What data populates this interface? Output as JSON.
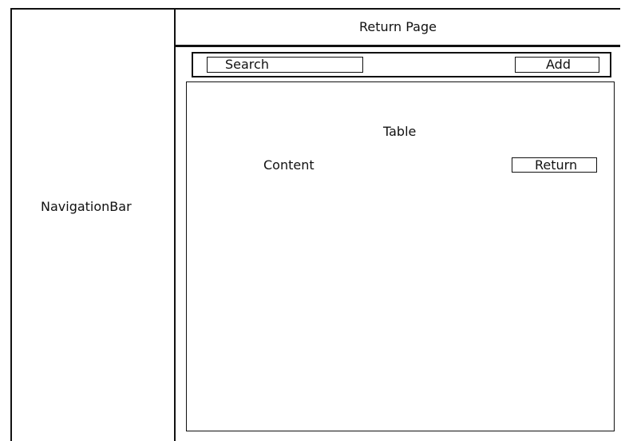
{
  "header": {
    "title": "Return Page"
  },
  "navigation": {
    "label": "NavigationBar"
  },
  "toolbar": {
    "search_label": "Search",
    "add_label": "Add"
  },
  "content": {
    "table_label": "Table",
    "content_label": "Content",
    "return_label": "Return"
  }
}
